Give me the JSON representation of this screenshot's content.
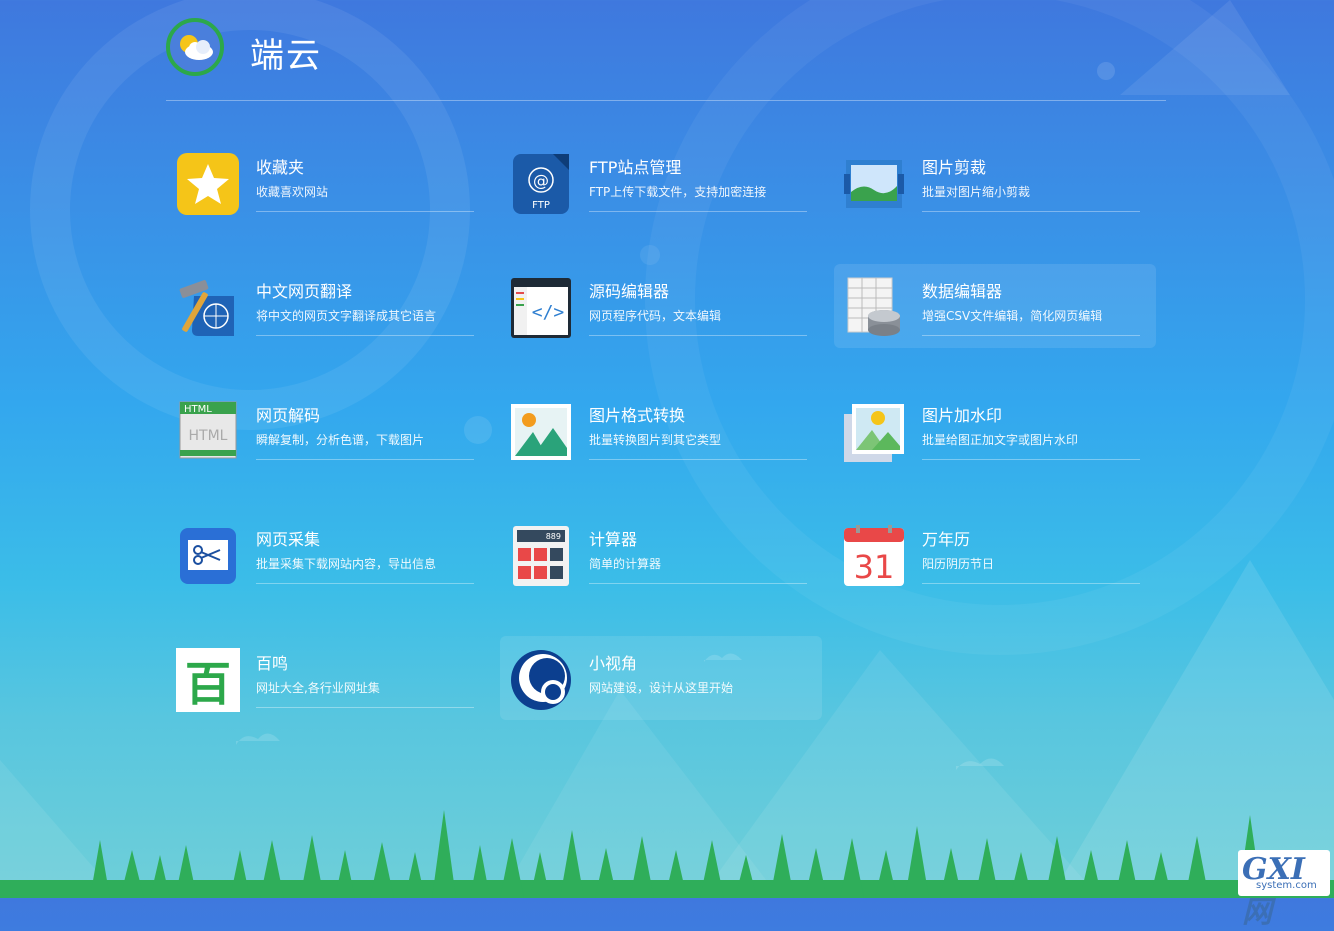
{
  "header": {
    "site_title": "端云",
    "logo_icon": "cloud-sun-icon"
  },
  "apps": [
    {
      "name": "收藏夹",
      "desc": "收藏喜欢网站",
      "icon": "star-icon"
    },
    {
      "name": "FTP站点管理",
      "desc": "FTP上传下载文件，支持加密连接",
      "icon": "ftp-icon"
    },
    {
      "name": "图片剪裁",
      "desc": "批量对图片缩小剪裁",
      "icon": "image-crop-icon"
    },
    {
      "name": "中文网页翻译",
      "desc": "将中文的网页文字翻译成其它语言",
      "icon": "translate-icon"
    },
    {
      "name": "源码编辑器",
      "desc": "网页程序代码，文本编辑",
      "icon": "code-editor-icon"
    },
    {
      "name": "数据编辑器",
      "desc": "增强CSV文件编辑，简化网页编辑",
      "icon": "database-icon"
    },
    {
      "name": "网页解码",
      "desc": "瞬解复制，分析色谱，下载图片",
      "icon": "html-icon"
    },
    {
      "name": "图片格式转换",
      "desc": "批量转换图片到其它类型",
      "icon": "image-convert-icon"
    },
    {
      "name": "图片加水印",
      "desc": "批量给图正加文字或图片水印",
      "icon": "watermark-icon"
    },
    {
      "name": "网页采集",
      "desc": "批量采集下载网站内容，导出信息",
      "icon": "scissors-icon"
    },
    {
      "name": "计算器",
      "desc": "简单的计算器",
      "icon": "calculator-icon"
    },
    {
      "name": "万年历",
      "desc": "阳历阴历节日",
      "icon": "calendar-icon"
    },
    {
      "name": "百鸣",
      "desc": "网址大全,各行业网址集",
      "icon": "bai-icon"
    },
    {
      "name": "小视角",
      "desc": "网站建设，设计从这里开始",
      "icon": "circle-eye-icon"
    }
  ],
  "icon_text": {
    "ftp_at": "@",
    "ftp_label": "FTP",
    "html_label": "HTML",
    "calc_display": "889",
    "calendar_day": "31",
    "bai_char": "百"
  },
  "colors": {
    "accent_green": "#2ca84a",
    "star_yellow": "#f5c518",
    "calendar_red": "#e94848"
  },
  "watermark": {
    "main": "GXI网",
    "sub": "system.com"
  }
}
